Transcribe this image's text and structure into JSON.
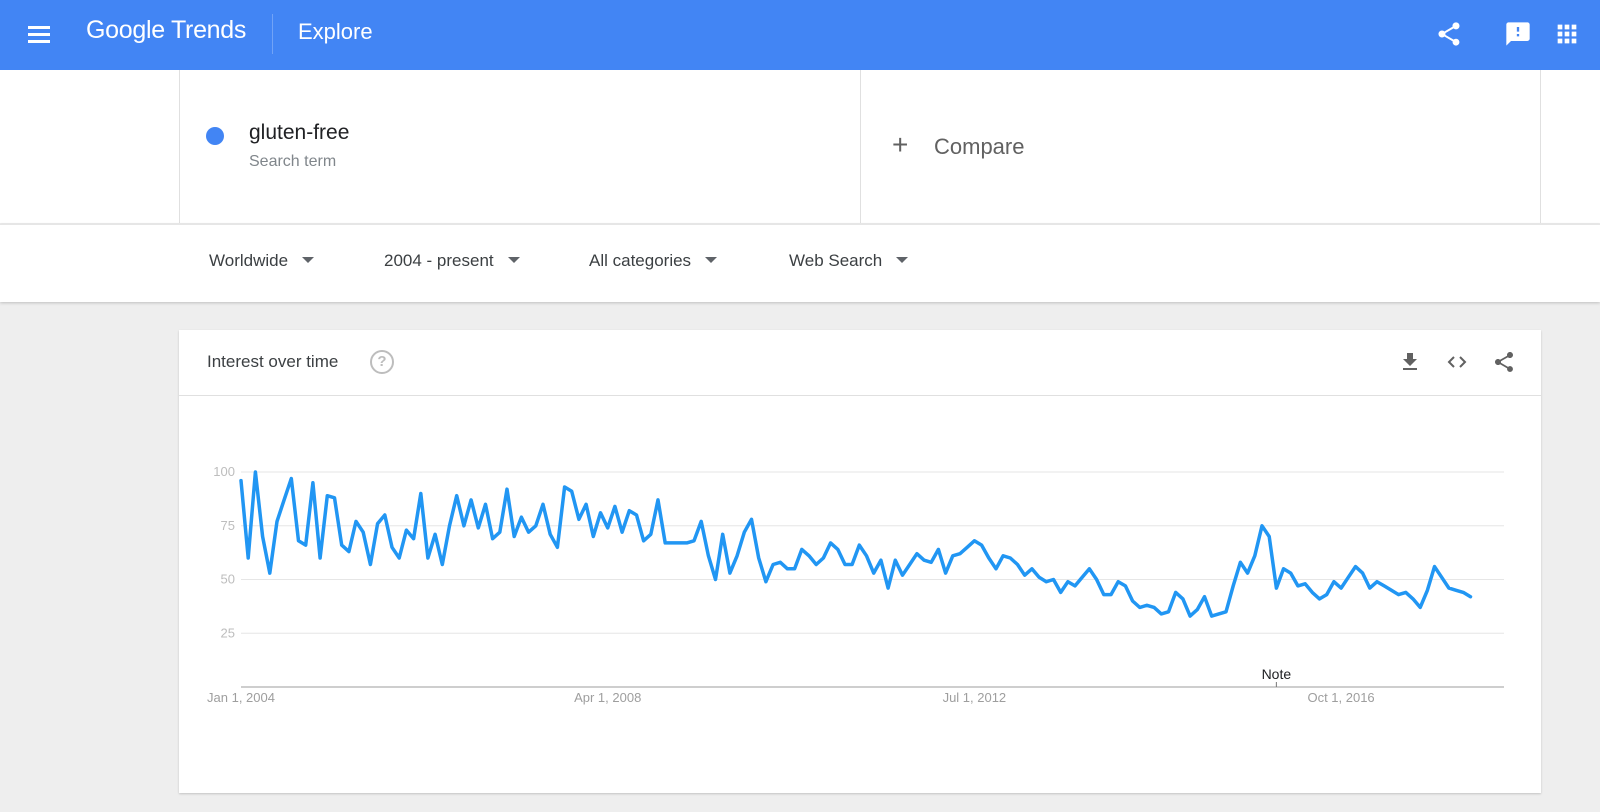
{
  "header": {
    "app_name": "Google Trends",
    "page": "Explore",
    "icons": [
      "menu-icon",
      "share-icon",
      "feedback-icon",
      "apps-icon"
    ]
  },
  "search": {
    "term": "gluten-free",
    "term_type": "Search term",
    "term_color": "#4285f4",
    "compare_label": "Compare"
  },
  "filters": [
    {
      "label": "Worldwide"
    },
    {
      "label": "2004 - present"
    },
    {
      "label": "All categories"
    },
    {
      "label": "Web Search"
    }
  ],
  "card": {
    "title": "Interest over time",
    "icons": [
      "help-icon",
      "download-icon",
      "embed-icon",
      "share-icon"
    ]
  },
  "chart_data": {
    "type": "line",
    "title": "Interest over time",
    "xlabel": "",
    "ylabel": "",
    "ylim": [
      0,
      100
    ],
    "yticks": [
      25,
      50,
      75,
      100
    ],
    "x_start": "Jan 2004",
    "x_interval": "month",
    "xticks": [
      {
        "label": "Jan 1, 2004",
        "index": 0
      },
      {
        "label": "Apr 1, 2008",
        "index": 51
      },
      {
        "label": "Jul 1, 2012",
        "index": 102
      },
      {
        "label": "Oct 1, 2016",
        "index": 153
      }
    ],
    "grid": true,
    "annotations": [
      {
        "label": "Note",
        "index": 144
      }
    ],
    "series": [
      {
        "name": "gluten-free",
        "color": "#2196f3",
        "values": [
          96,
          60,
          100,
          70,
          53,
          77,
          87,
          97,
          68,
          66,
          95,
          60,
          89,
          88,
          66,
          63,
          77,
          72,
          57,
          76,
          80,
          65,
          60,
          73,
          69,
          90,
          60,
          71,
          57,
          75,
          89,
          75,
          87,
          74,
          85,
          69,
          72,
          92,
          70,
          79,
          72,
          75,
          85,
          71,
          65,
          93,
          91,
          78,
          85,
          70,
          81,
          74,
          84,
          72,
          82,
          80,
          68,
          71,
          87,
          67,
          67,
          67,
          67,
          68,
          77,
          61,
          50,
          71,
          53,
          61,
          72,
          78,
          60,
          49,
          57,
          58,
          55,
          55,
          64,
          61,
          57,
          60,
          67,
          64,
          57,
          57,
          66,
          61,
          53,
          59,
          46,
          59,
          52,
          57,
          62,
          59,
          58,
          64,
          53,
          61,
          62,
          65,
          68,
          66,
          60,
          55,
          61,
          60,
          57,
          52,
          55,
          51,
          49,
          50,
          44,
          49,
          47,
          51,
          55,
          50,
          43,
          43,
          49,
          47,
          40,
          37,
          38,
          37,
          34,
          35,
          44,
          41,
          33,
          36,
          42,
          33,
          34,
          35,
          47,
          58,
          53,
          61,
          75,
          70,
          46,
          55,
          53,
          47,
          48,
          44,
          41,
          43,
          49,
          46,
          51,
          56,
          53,
          46,
          49,
          47,
          45,
          43,
          44,
          41,
          37,
          45,
          56,
          51,
          46,
          45,
          44,
          42
        ]
      }
    ]
  }
}
